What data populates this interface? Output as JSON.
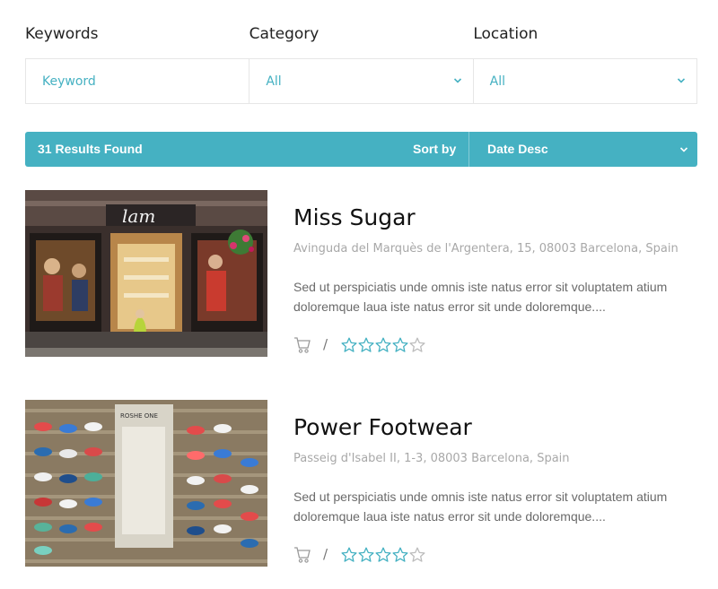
{
  "filters": {
    "keywords_label": "Keywords",
    "category_label": "Category",
    "location_label": "Location",
    "keyword_placeholder": "Keyword",
    "category_value": "All",
    "location_value": "All"
  },
  "results_bar": {
    "count_text": "31 Results Found",
    "sort_label": "Sort by",
    "sort_value": "Date Desc"
  },
  "listings": [
    {
      "title": "Miss Sugar",
      "address": "Avinguda del Marquès de l'Argentera, 15, 08003 Barcelona, Spain",
      "description": "Sed ut perspiciatis unde omnis iste natus error sit voluptatem atium doloremque laua iste natus error sit unde doloremque....",
      "separator": "/",
      "rating": 4,
      "rating_max": 5,
      "storefront_sign": "lam"
    },
    {
      "title": "Power Footwear",
      "address": "Passeig d'Isabel II, 1-3, 08003 Barcelona, Spain",
      "description": "Sed ut perspiciatis unde omnis iste natus error sit voluptatem atium doloremque laua iste natus error sit unde doloremque....",
      "separator": "/",
      "rating": 4,
      "rating_max": 5,
      "display_sign": "ROSHE ONE"
    }
  ],
  "colors": {
    "accent": "#45b1c2",
    "star_empty": "#bdbdbd",
    "border": "#e6e6e6"
  },
  "icons": {
    "dropdown": "chevron-down-icon",
    "category": "cart-icon",
    "rating": "star-icon"
  }
}
